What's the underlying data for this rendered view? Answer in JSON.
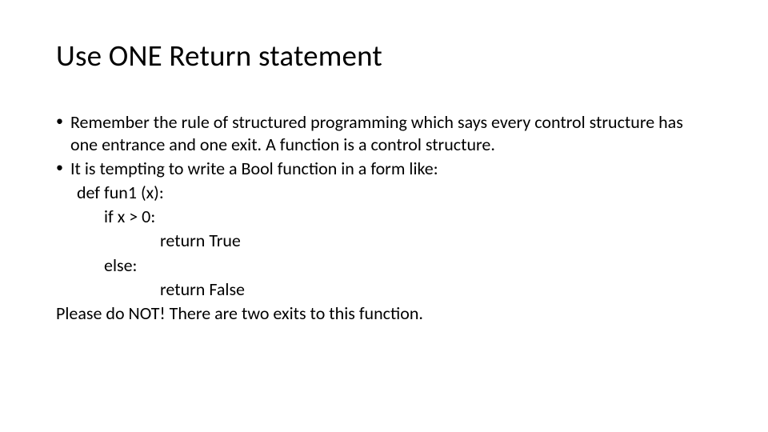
{
  "title": "Use ONE Return statement",
  "bullets": [
    "Remember the rule of structured programming which says every control structure has one entrance and one exit.  A function is a control structure.",
    "It is tempting to write a Bool function in a form like:"
  ],
  "code": {
    "line1": "def fun1 (x):",
    "line2": "if x > 0:",
    "line3": "return True",
    "line4": "else:",
    "line5": "return False"
  },
  "final": "Please do NOT!  There are two exits to this function."
}
